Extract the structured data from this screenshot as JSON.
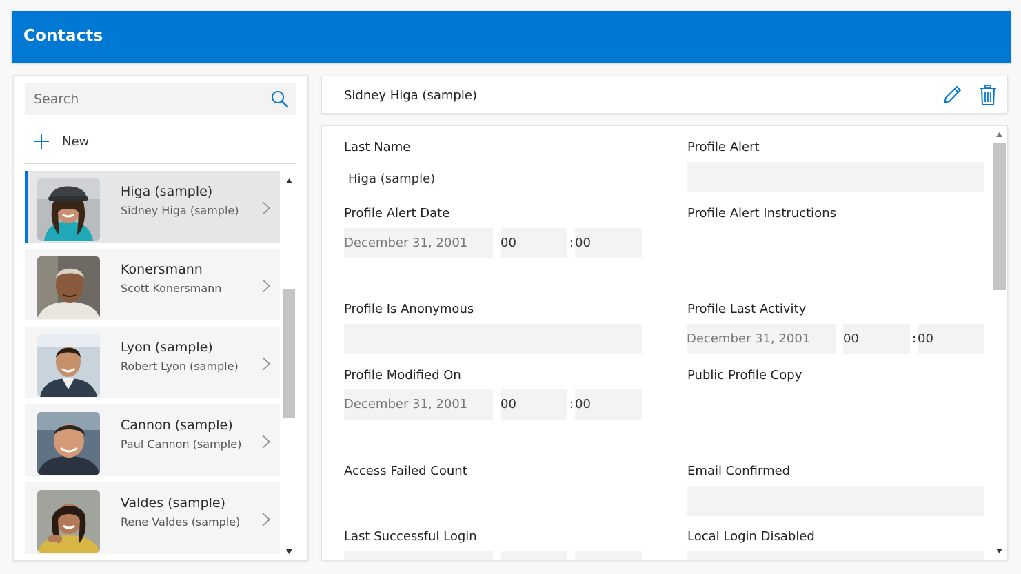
{
  "app": {
    "title": "Contacts"
  },
  "colors": {
    "accent": "#0078d4",
    "selected_row": "#e6e6e6",
    "field_bg": "#f3f3f3"
  },
  "search": {
    "placeholder": "Search",
    "icon": "search-icon"
  },
  "new_button": {
    "label": "New",
    "icon": "plus-icon"
  },
  "contacts": [
    {
      "primary": "Higa (sample)",
      "secondary": "Sidney Higa (sample)",
      "selected": true
    },
    {
      "primary": "Konersmann",
      "secondary": "Scott Konersmann",
      "selected": false
    },
    {
      "primary": "Lyon (sample)",
      "secondary": "Robert Lyon (sample)",
      "selected": false
    },
    {
      "primary": "Cannon (sample)",
      "secondary": "Paul Cannon (sample)",
      "selected": false
    },
    {
      "primary": "Valdes (sample)",
      "secondary": "Rene Valdes (sample)",
      "selected": false
    }
  ],
  "detail": {
    "title": "Sidney Higa (sample)",
    "edit_icon": "pencil-icon",
    "delete_icon": "trash-icon"
  },
  "form": {
    "last_name": {
      "label": "Last Name",
      "value": "Higa (sample)"
    },
    "profile_alert": {
      "label": "Profile Alert",
      "value": ""
    },
    "profile_alert_date": {
      "label": "Profile Alert Date",
      "date": "December 31, 2001",
      "hour": "00",
      "minute": "00"
    },
    "profile_alert_instructions": {
      "label": "Profile Alert Instructions"
    },
    "profile_is_anonymous": {
      "label": "Profile Is Anonymous",
      "value": ""
    },
    "profile_last_activity": {
      "label": "Profile Last Activity",
      "date": "December 31, 2001",
      "hour": "00",
      "minute": "00"
    },
    "profile_modified_on": {
      "label": "Profile Modified On",
      "date": "December 31, 2001",
      "hour": "00",
      "minute": "00"
    },
    "public_profile_copy": {
      "label": "Public Profile Copy"
    },
    "access_failed_count": {
      "label": "Access Failed Count"
    },
    "email_confirmed": {
      "label": "Email Confirmed",
      "value": ""
    },
    "last_successful_login": {
      "label": "Last Successful Login"
    },
    "local_login_disabled": {
      "label": "Local Login Disabled"
    },
    "time_separator": ":"
  }
}
